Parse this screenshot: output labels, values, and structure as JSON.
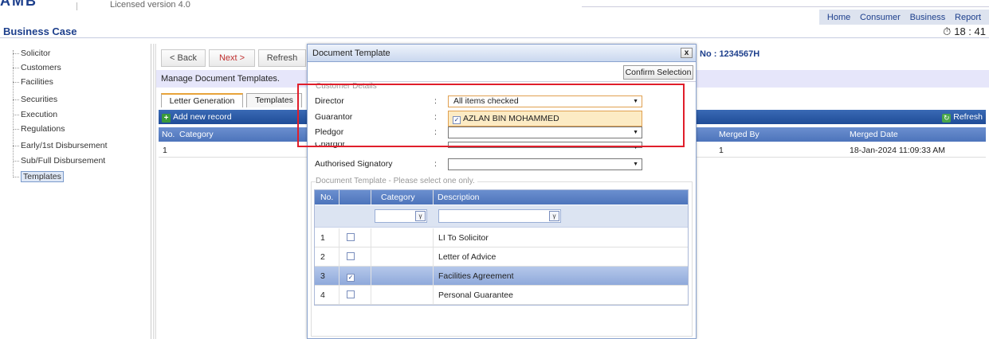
{
  "header": {
    "logo_text": "AMB",
    "license_text": "Licensed version 4.0",
    "nav": [
      "Home",
      "Consumer",
      "Business",
      "Report"
    ]
  },
  "page": {
    "title": "Business Case",
    "clock": "18 : 41"
  },
  "sidebar": {
    "items": [
      {
        "label": "Solicitor"
      },
      {
        "label": "Customers"
      },
      {
        "label": "Facilities"
      },
      {
        "label": "Securities"
      },
      {
        "label": "Execution"
      },
      {
        "label": "Regulations"
      },
      {
        "label": "Early/1st Disbursement"
      },
      {
        "label": "Sub/Full Disbursement"
      },
      {
        "label": "Templates"
      }
    ],
    "selected": "Templates"
  },
  "toolbar": {
    "back_label": "< Back",
    "next_label": "Next >",
    "refresh_label": "Refresh"
  },
  "ref_no": "No : 1234567H",
  "main": {
    "subheader": "Manage Document Templates.",
    "tabs": [
      {
        "label": "Letter Generation"
      },
      {
        "label": "Templates"
      }
    ],
    "add_record_label": "Add new record",
    "grid_refresh_label": "Refresh",
    "columns": [
      "No.",
      "Category",
      "Merged By",
      "Merged Date"
    ],
    "rows": [
      {
        "no": "1",
        "merged_by": "1",
        "merged_date": "18-Jan-2024 11:09:33 AM"
      }
    ]
  },
  "modal": {
    "title": "Document Template",
    "close_label": "x",
    "confirm_label": "Confirm Selection",
    "customer_legend": "Customer Details",
    "fields": [
      {
        "label": "Director",
        "value": "All items checked"
      },
      {
        "label": "Guarantor",
        "value": ""
      },
      {
        "label": "Pledgor",
        "value": ""
      },
      {
        "label": "Chargor",
        "value": ""
      },
      {
        "label": "Authorised Signatory",
        "value": ""
      }
    ],
    "colon": ":",
    "dropdown_item": "AZLAN BIN MOHAMMED",
    "doc_legend": "Document Template - Please select one only.",
    "doc_columns": [
      "No.",
      "Category",
      "Description"
    ],
    "doc_rows": [
      {
        "no": "1",
        "checked": false,
        "description": "LI To Solicitor"
      },
      {
        "no": "2",
        "checked": false,
        "description": "Letter of Advice"
      },
      {
        "no": "3",
        "checked": true,
        "description": "Facilities Agreement"
      },
      {
        "no": "4",
        "checked": false,
        "description": "Personal Guarantee"
      }
    ]
  },
  "colors": {
    "accent": "#1d3f8c",
    "grid_header": "#4d74bb",
    "highlight": "#e01e2b",
    "dropdown_hover": "#fcebc4"
  }
}
